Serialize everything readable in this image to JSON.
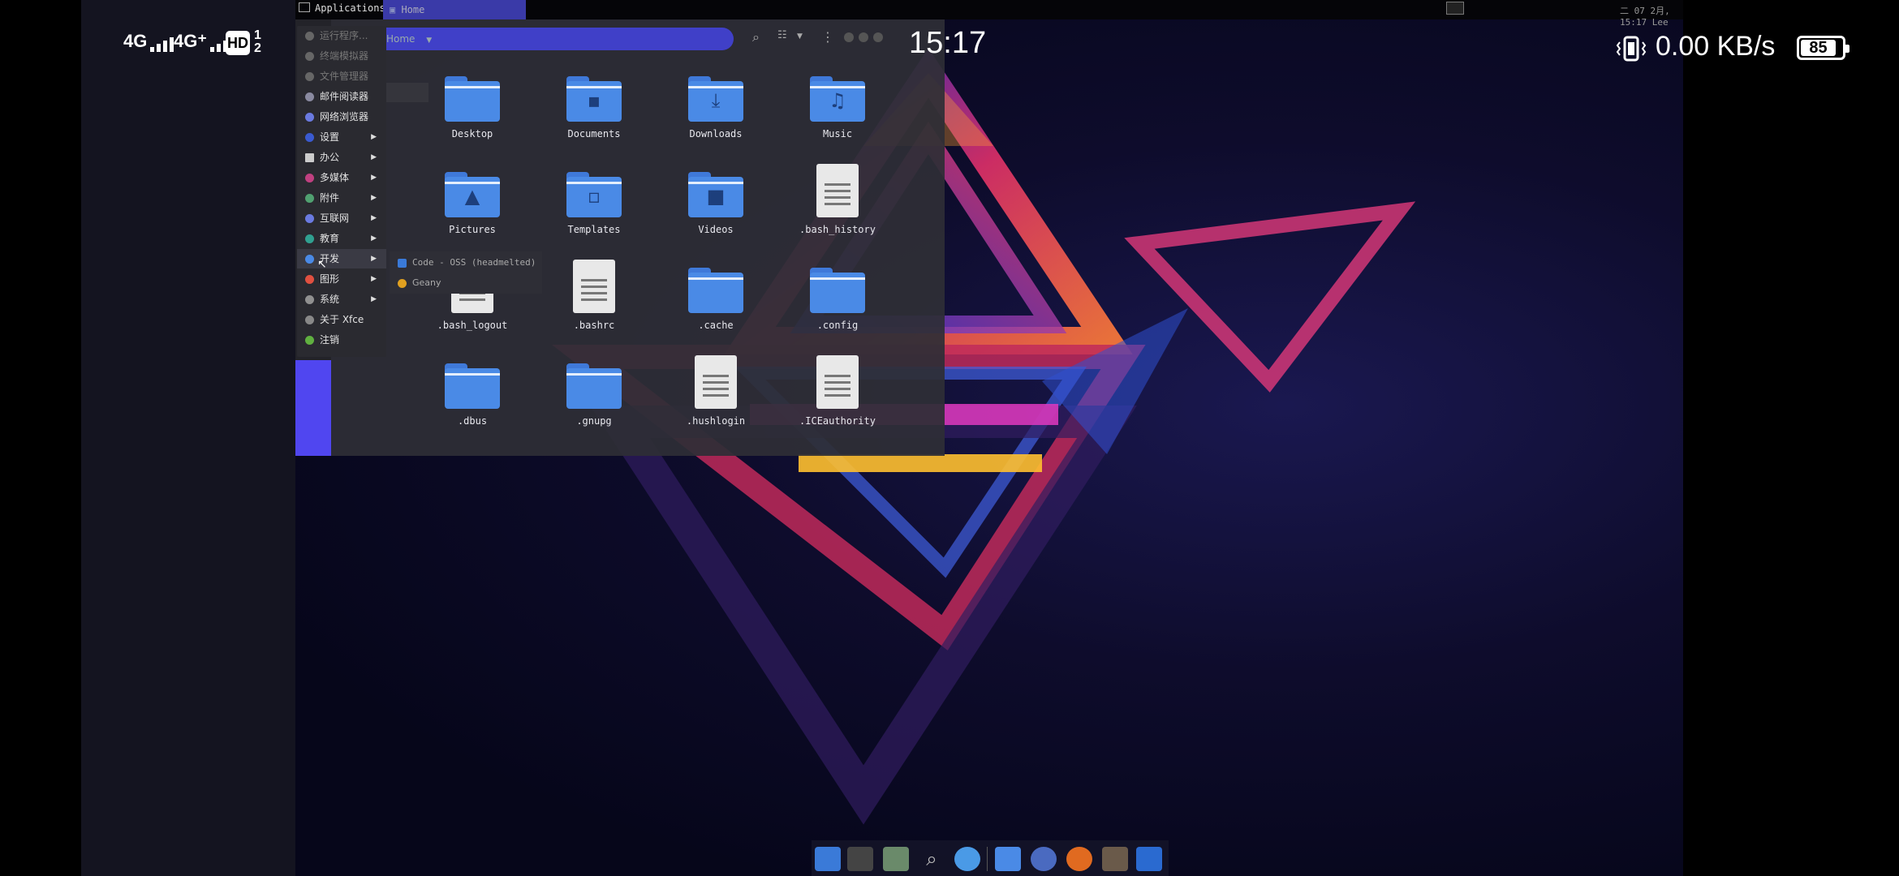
{
  "android_status": {
    "signal1": "4G",
    "signal2": "4G⁺",
    "hd": "HD",
    "hd_sub_top": "1",
    "hd_sub_bottom": "2",
    "time": "15:17",
    "net_speed": "0.00 KB/s",
    "battery": "85"
  },
  "panel": {
    "applications_label": "Applications",
    "task_label": "Home",
    "clock": "二 07 2月, 15:17 Lee"
  },
  "file_manager": {
    "path": "Home",
    "items": [
      {
        "name": "Desktop",
        "kind": "folder",
        "glyph": ""
      },
      {
        "name": "Documents",
        "kind": "folder",
        "glyph": "▪"
      },
      {
        "name": "Downloads",
        "kind": "folder",
        "glyph": "⤓"
      },
      {
        "name": "Music",
        "kind": "folder",
        "glyph": "♫"
      },
      {
        "name": "Pictures",
        "kind": "folder",
        "glyph": "▲"
      },
      {
        "name": "Templates",
        "kind": "folder",
        "glyph": "▫"
      },
      {
        "name": "Videos",
        "kind": "folder",
        "glyph": "■"
      },
      {
        "name": ".bash_history",
        "kind": "file",
        "glyph": ""
      },
      {
        "name": ".bash_logout",
        "kind": "file",
        "glyph": ""
      },
      {
        "name": ".bashrc",
        "kind": "file",
        "glyph": ""
      },
      {
        "name": ".cache",
        "kind": "folder",
        "glyph": ""
      },
      {
        "name": ".config",
        "kind": "folder",
        "glyph": ""
      },
      {
        "name": ".dbus",
        "kind": "folder",
        "glyph": ""
      },
      {
        "name": ".gnupg",
        "kind": "folder",
        "glyph": ""
      },
      {
        "name": ".hushlogin",
        "kind": "file",
        "glyph": ""
      },
      {
        "name": ".ICEauthority",
        "kind": "file",
        "glyph": ""
      }
    ]
  },
  "app_menu": {
    "items": [
      {
        "label": "运行程序...",
        "dim": true,
        "submenu": false,
        "color": "#666"
      },
      {
        "label": "终端模拟器",
        "dim": true,
        "submenu": false,
        "color": "#666"
      },
      {
        "label": "文件管理器",
        "dim": true,
        "submenu": false,
        "color": "#666"
      },
      {
        "label": "邮件阅读器",
        "dim": false,
        "submenu": false,
        "color": "#8a8aa0"
      },
      {
        "label": "网络浏览器",
        "dim": false,
        "submenu": false,
        "color": "#6a7ae0"
      },
      {
        "label": "设置",
        "dim": false,
        "submenu": true,
        "color": "#3a5ad0"
      },
      {
        "label": "办公",
        "dim": false,
        "submenu": true,
        "color": "#cccccc"
      },
      {
        "label": "多媒体",
        "dim": false,
        "submenu": true,
        "color": "#c04080"
      },
      {
        "label": "附件",
        "dim": false,
        "submenu": true,
        "color": "#50a070"
      },
      {
        "label": "互联网",
        "dim": false,
        "submenu": true,
        "color": "#6a7ae0"
      },
      {
        "label": "教育",
        "dim": false,
        "submenu": true,
        "color": "#30a090"
      },
      {
        "label": "开发",
        "dim": false,
        "submenu": true,
        "color": "#4a8ae6"
      },
      {
        "label": "图形",
        "dim": false,
        "submenu": true,
        "color": "#e05040"
      },
      {
        "label": "系统",
        "dim": false,
        "submenu": true,
        "color": "#909090"
      },
      {
        "label": "关于 Xfce",
        "dim": false,
        "submenu": false,
        "color": "#888888"
      },
      {
        "label": "注销",
        "dim": false,
        "submenu": false,
        "color": "#60b040"
      }
    ],
    "dev_submenu": [
      {
        "label": "Code - OSS (headmelted)"
      },
      {
        "label": "Geany"
      }
    ]
  },
  "dock": {
    "apps": [
      "show-desktop-icon",
      "terminal-icon",
      "file-manager-icon",
      "search-icon",
      "chromium-icon",
      "folder-icon",
      "audacious-icon",
      "firefox-icon",
      "gimp-icon",
      "code-oss-icon"
    ]
  },
  "colors": {
    "accent": "#4a4adf",
    "folder_blue": "#4a8ae6"
  }
}
